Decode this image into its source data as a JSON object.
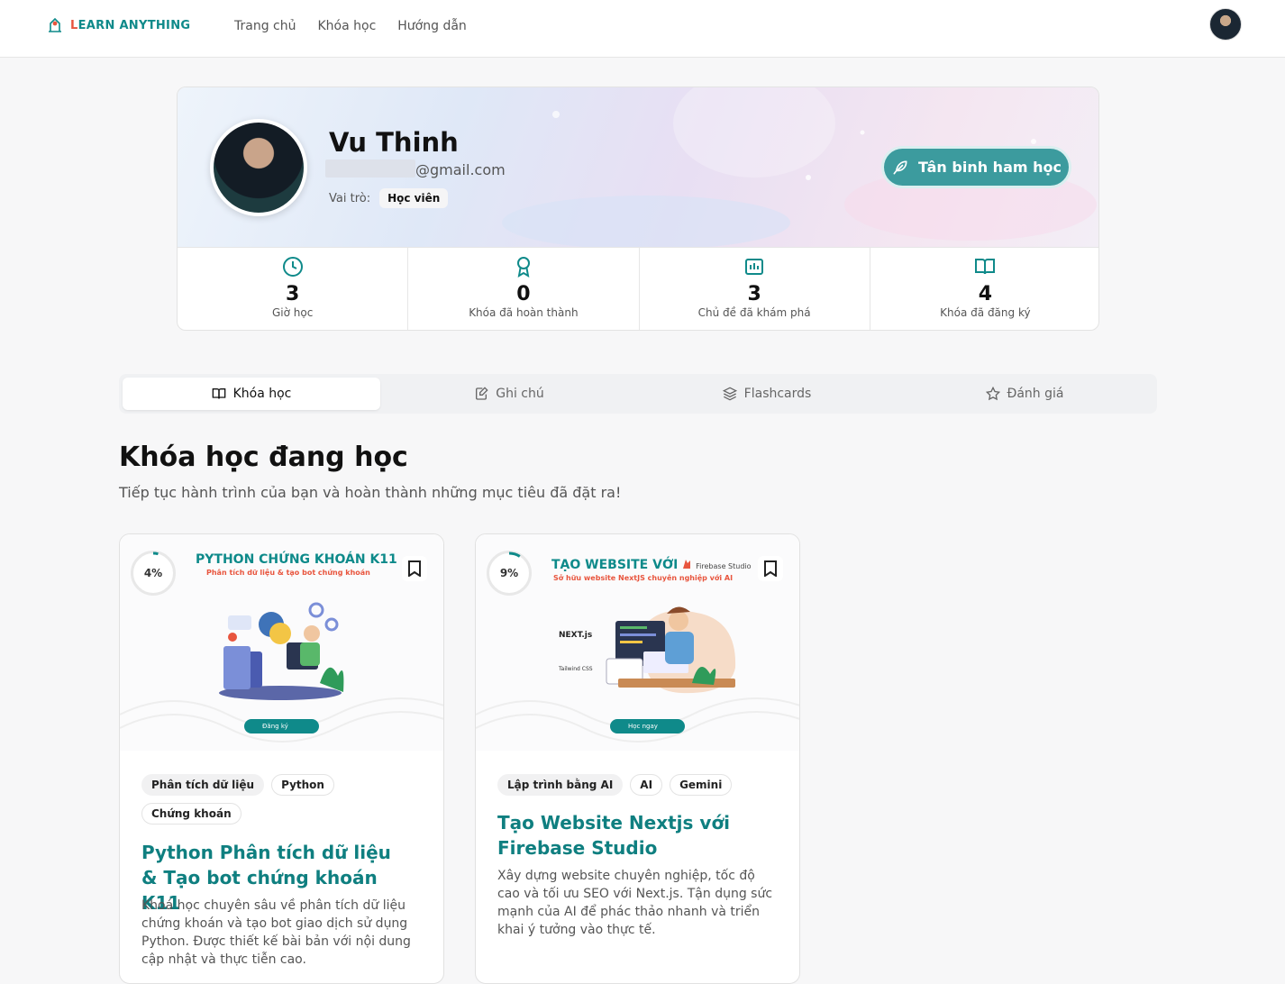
{
  "nav": {
    "logo_text_l": "L",
    "logo_text_rest": "EARN ANYTHING",
    "links": [
      "Trang chủ",
      "Khóa học",
      "Hướng dẫn"
    ]
  },
  "profile": {
    "name": "Vu Thinh",
    "email_suffix": "@gmail.com",
    "role_label": "Vai trò:",
    "role_value": "Học viên",
    "rank_button": "Tân binh ham học",
    "stats": [
      {
        "value": "3",
        "label": "Giờ học",
        "icon": "clock-icon"
      },
      {
        "value": "0",
        "label": "Khóa đã hoàn thành",
        "icon": "award-icon"
      },
      {
        "value": "3",
        "label": "Chủ đề đã khám phá",
        "icon": "chart-icon"
      },
      {
        "value": "4",
        "label": "Khóa đã đăng ký",
        "icon": "book-open-icon"
      }
    ]
  },
  "tabs": [
    {
      "label": "Khóa học",
      "active": true,
      "icon": "book-open-icon"
    },
    {
      "label": "Ghi chú",
      "active": false,
      "icon": "note-edit-icon"
    },
    {
      "label": "Flashcards",
      "active": false,
      "icon": "layers-icon"
    },
    {
      "label": "Đánh giá",
      "active": false,
      "icon": "star-icon"
    }
  ],
  "section": {
    "title": "Khóa học đang học",
    "subtitle": "Tiếp tục hành trình của bạn và hoàn thành những mục tiêu đã đặt ra!"
  },
  "courses": [
    {
      "progress": 0.04,
      "progress_text": "4%",
      "thumb_title": "PYTHON CHỨNG KHOÁN K11",
      "thumb_sub": "Phân tích dữ liệu & tạo bot chứng khoán",
      "thumb_cta": "Đăng ký",
      "tags": [
        "Phân tích dữ liệu",
        "Python",
        "Chứng khoán"
      ],
      "title": "Python Phân tích dữ liệu & Tạo bot chứng khoán K11",
      "desc": "Khoá học chuyên sâu về phân tích dữ liệu chứng khoán và tạo bot giao dịch sử dụng Python. Được thiết kế bài bản với nội dung cập nhật và thực tiễn cao."
    },
    {
      "progress": 0.09,
      "progress_text": "9%",
      "thumb_title": "TẠO WEBSITE VỚI",
      "thumb_brand": "Firebase Studio",
      "thumb_sub": "Sở hữu website NextJS chuyên nghiệp với AI",
      "thumb_cta": "Học ngay",
      "thumb_next": "NEXT.js",
      "thumb_tailwind": "Tailwind CSS",
      "tags": [
        "Lập trình bằng AI",
        "AI",
        "Gemini"
      ],
      "title": "Tạo Website Nextjs với Firebase Studio",
      "desc": "Xây dựng website chuyên nghiệp, tốc độ cao và tối ưu SEO với Next.js. Tận dụng sức mạnh của AI để phác thảo nhanh và triển khai ý tưởng vào thực tế."
    }
  ],
  "colors": {
    "accent": "#0f8a8a",
    "brand_red": "#e8553e",
    "rank_button": "#3c9b9e"
  }
}
